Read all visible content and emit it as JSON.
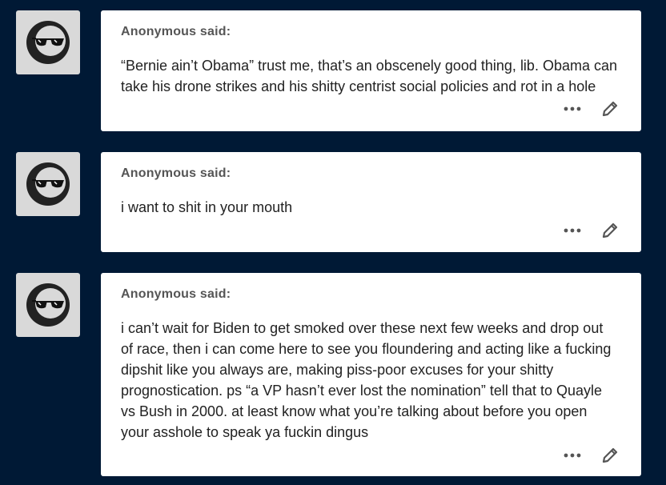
{
  "theme": {
    "background": "#001935",
    "card": "#ffffff",
    "avatar_bg": "#d9d9d9"
  },
  "icons": {
    "avatar": "anonymous-sunglasses-moon-icon",
    "more": "ellipsis-icon",
    "edit": "pencil-icon"
  },
  "asks": [
    {
      "asker": "Anonymous said:",
      "question": "“Bernie ain’t Obama” trust me, that’s an obscenely good thing, lib. Obama can take his drone strikes and his shitty centrist social policies and rot in a hole"
    },
    {
      "asker": "Anonymous said:",
      "question": "i want to shit in your mouth"
    },
    {
      "asker": "Anonymous said:",
      "question": "i can’t wait for Biden to get smoked over these next few weeks and drop out of race, then i can come here to see you floundering and acting like a fucking dipshit like you always are, making piss-poor excuses for your shitty prognostication. ps “a VP hasn’t ever lost the nomination” tell that to Quayle vs Bush in 2000. at least know what you’re talking about before you open your asshole to speak ya fuckin dingus"
    }
  ]
}
